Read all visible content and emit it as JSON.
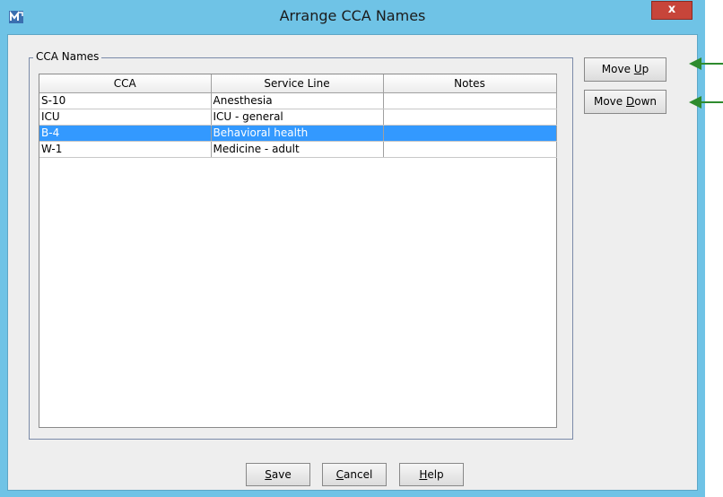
{
  "window": {
    "title": "Arrange CCA Names",
    "close_label": "x"
  },
  "group": {
    "label": "CCA Names"
  },
  "table": {
    "columns": [
      "CCA",
      "Service Line",
      "Notes"
    ],
    "rows": [
      {
        "cca": "S-10",
        "service_line": "Anesthesia",
        "notes": "",
        "selected": false
      },
      {
        "cca": "ICU",
        "service_line": "ICU - general",
        "notes": "",
        "selected": false
      },
      {
        "cca": "B-4",
        "service_line": "Behavioral health",
        "notes": "",
        "selected": true
      },
      {
        "cca": "W-1",
        "service_line": "Medicine - adult",
        "notes": "",
        "selected": false
      }
    ]
  },
  "buttons": {
    "move_up": {
      "pre": "Move ",
      "mnemonic": "U",
      "post": "p"
    },
    "move_down": {
      "pre": "Move ",
      "mnemonic": "D",
      "post": "own"
    },
    "save": {
      "pre": "",
      "mnemonic": "S",
      "post": "ave"
    },
    "cancel": {
      "pre": "",
      "mnemonic": "C",
      "post": "ancel"
    },
    "help": {
      "pre": "",
      "mnemonic": "H",
      "post": "elp"
    }
  },
  "colors": {
    "title_bar": "#6fc3e6",
    "selection": "#3399ff",
    "arrow": "#2e8b2e",
    "close": "#c7453a"
  },
  "icons": {
    "app": "app-icon",
    "close": "close-icon",
    "arrow": "left-arrow-icon"
  }
}
